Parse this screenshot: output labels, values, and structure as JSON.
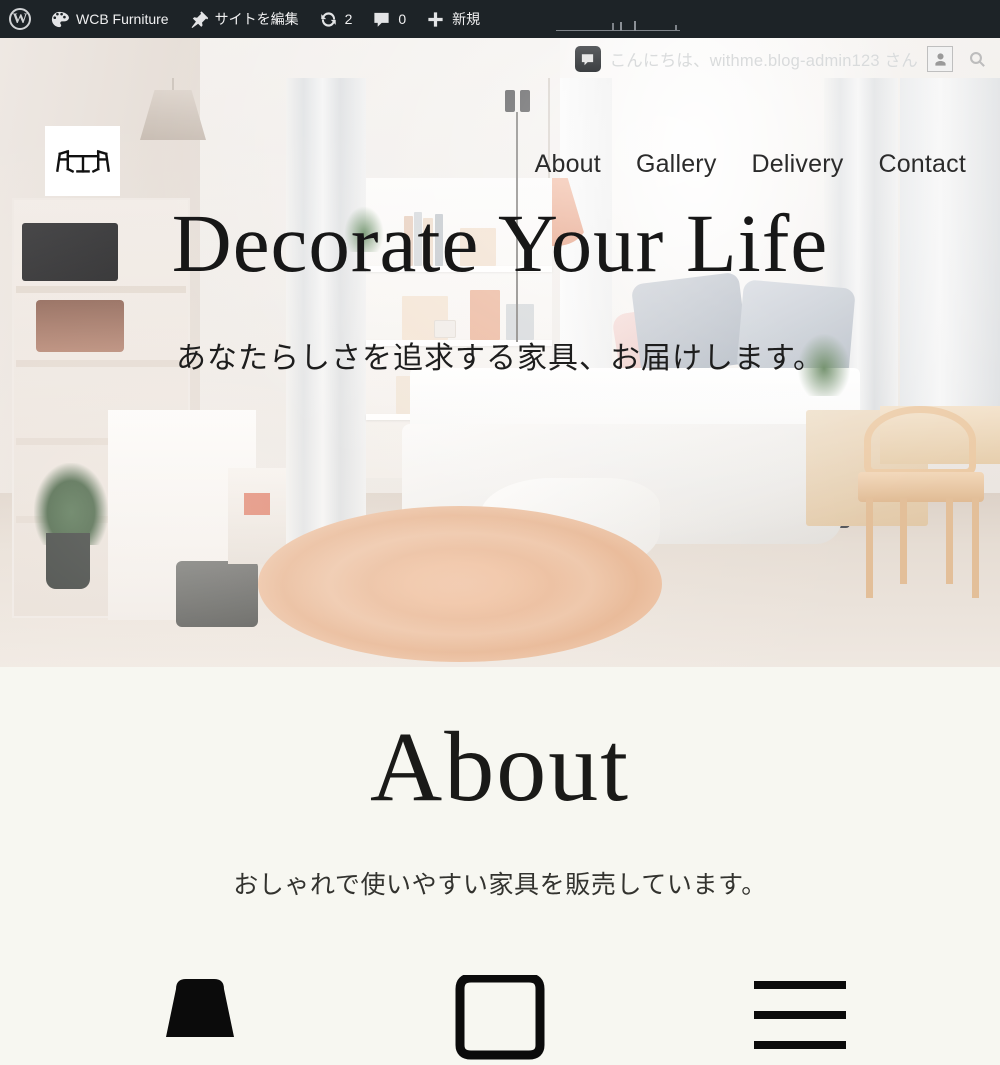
{
  "adminbar": {
    "items": [
      {
        "name": "wp-logo",
        "icon": "wordpress-icon",
        "label": ""
      },
      {
        "name": "site-name",
        "icon": "palette-icon",
        "label": "WCB Furniture"
      },
      {
        "name": "edit-site",
        "icon": "pin-icon",
        "label": "サイトを編集"
      },
      {
        "name": "updates",
        "icon": "update-icon",
        "label": "2"
      },
      {
        "name": "comments",
        "icon": "comment-icon",
        "label": "0"
      },
      {
        "name": "new-content",
        "icon": "plus-icon",
        "label": "新規"
      }
    ],
    "greeting": "こんにちは、withme.blog-admin123 さん",
    "greeting_comment_icon": "comment-bubble-icon",
    "avatar_icon": "user-avatar-icon",
    "search_icon": "search-icon",
    "bar_bg": "#1d2327",
    "bar_text": "#f0f0f1"
  },
  "site": {
    "logo_icon": "table-and-chairs-icon",
    "nav": [
      {
        "label": "About"
      },
      {
        "label": "Gallery"
      },
      {
        "label": "Delivery"
      },
      {
        "label": "Contact"
      }
    ]
  },
  "hero": {
    "title": "Decorate Your Life",
    "subtitle": "あなたらしさを追求する家具、お届けします。",
    "title_color": "#171717"
  },
  "about": {
    "heading": "About",
    "lead": "おしゃれで使いやすい家具を販売しています。",
    "bg": "#F7F7F1",
    "icons": [
      {
        "name": "lamp-icon"
      },
      {
        "name": "sofa-icon"
      },
      {
        "name": "shelf-icon"
      }
    ]
  }
}
